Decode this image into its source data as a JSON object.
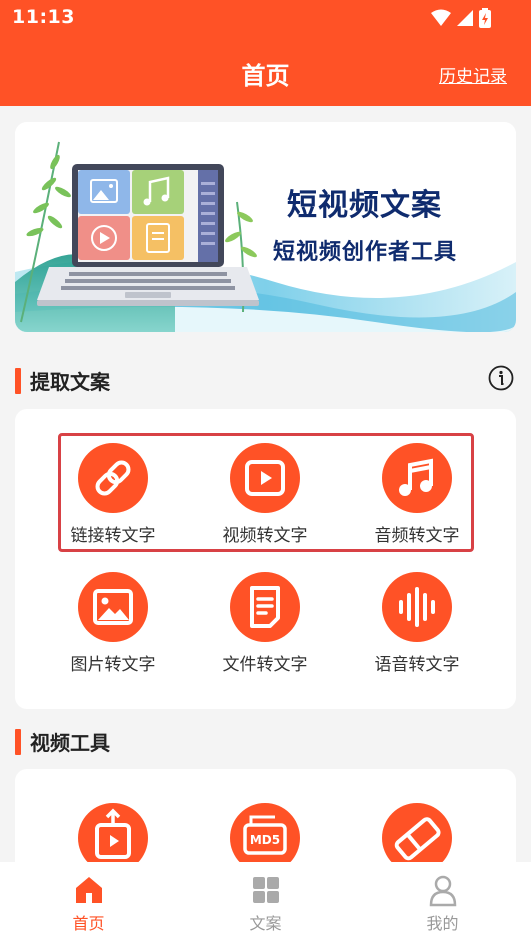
{
  "status_bar": {
    "time": "11:13"
  },
  "header": {
    "title": "首页",
    "history_link": "历史记录"
  },
  "banner": {
    "title": "短视频文案",
    "subtitle": "短视频创作者工具"
  },
  "sections": {
    "extract": {
      "title": "提取文案",
      "tools": [
        {
          "label": "链接转文字",
          "icon": "link-icon"
        },
        {
          "label": "视频转文字",
          "icon": "video-play-icon"
        },
        {
          "label": "音频转文字",
          "icon": "music-note-icon"
        },
        {
          "label": "图片转文字",
          "icon": "image-icon"
        },
        {
          "label": "文件转文字",
          "icon": "document-icon"
        },
        {
          "label": "语音转文字",
          "icon": "sound-wave-icon"
        }
      ]
    },
    "video_tools": {
      "title": "视频工具",
      "tools": [
        {
          "icon": "video-share-icon"
        },
        {
          "icon": "md5-icon",
          "badge_text": "MD5"
        },
        {
          "icon": "eraser-icon"
        }
      ]
    }
  },
  "tabs": [
    {
      "label": "首页",
      "icon": "home-icon",
      "active": true
    },
    {
      "label": "文案",
      "icon": "grid-icon",
      "active": false
    },
    {
      "label": "我的",
      "icon": "profile-icon",
      "active": false
    }
  ],
  "colors": {
    "primary": "#ff5226",
    "highlight_border": "#d84145",
    "tab_inactive": "#aaaaaa",
    "background": "#f4f4f4"
  }
}
